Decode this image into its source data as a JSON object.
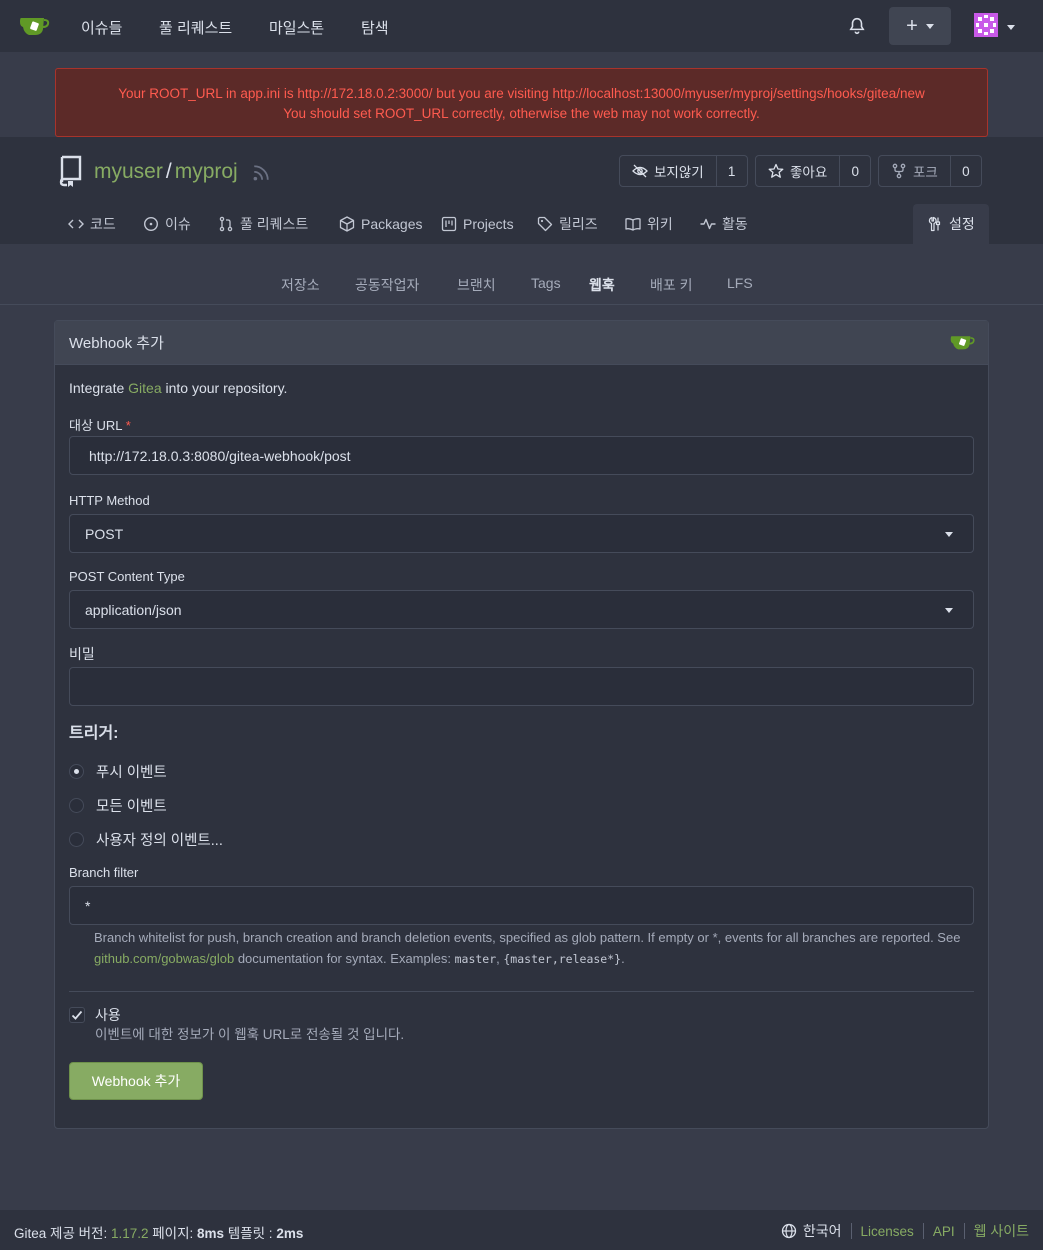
{
  "topnav": {
    "items": [
      "이슈들",
      "풀 리퀘스트",
      "마일스톤",
      "탐색"
    ],
    "plus_label": "+"
  },
  "warning": {
    "line1": "Your ROOT_URL in app.ini is http://172.18.0.2:3000/ but you are visiting http://localhost:13000/myuser/myproj/settings/hooks/gitea/new",
    "line2": "You should set ROOT_URL correctly, otherwise the web may not work correctly."
  },
  "repo": {
    "owner": "myuser",
    "separator": "/",
    "name": "myproj",
    "watch_label": "보지않기",
    "watch_count": "1",
    "star_label": "좋아요",
    "star_count": "0",
    "fork_label": "포크",
    "fork_count": "0"
  },
  "tabs": {
    "code": "코드",
    "issues": "이슈",
    "pulls": "풀 리퀘스트",
    "packages": "Packages",
    "projects": "Projects",
    "releases": "릴리즈",
    "wiki": "위키",
    "activity": "활동",
    "settings": "설정"
  },
  "subnav": [
    "저장소",
    "공동작업자",
    "브랜치",
    "Tags",
    "웹훅",
    "배포 키",
    "LFS"
  ],
  "panel": {
    "title": "Webhook 추가",
    "intro_prefix": "Integrate ",
    "intro_link": "Gitea",
    "intro_suffix": " into your repository.",
    "target_url_label": "대상 URL",
    "target_url_required": "*",
    "target_url_value": "http://172.18.0.3:8080/gitea-webhook/post",
    "http_method_label": "HTTP Method",
    "http_method_value": "POST",
    "content_type_label": "POST Content Type",
    "content_type_value": "application/json",
    "secret_label": "비밀",
    "secret_value": "",
    "triggers_title": "트리거:",
    "trigger_push": "푸시 이벤트",
    "trigger_all": "모든 이벤트",
    "trigger_custom": "사용자 정의 이벤트...",
    "branch_filter_label": "Branch filter",
    "branch_filter_value": "*",
    "help_prefix": "Branch whitelist for push, branch creation and branch deletion events, specified as glob pattern. If empty or *, events for all branches are reported. See ",
    "help_link": "github.com/gobwas/glob",
    "help_mid": " documentation for syntax. Examples: ",
    "help_code1": "master",
    "help_comma": ", ",
    "help_code2": "{master,release*}",
    "help_end": ".",
    "active_label": "사용",
    "active_help": "이벤트에 대한 정보가 이 웹훅 URL로 전송될 것 입니다.",
    "submit_label": "Webhook 추가"
  },
  "footer": {
    "powered_prefix": "Gitea 제공 버전: ",
    "version": "1.17.2",
    "page_prefix": " 페이지: ",
    "page_time": "8ms",
    "template_prefix": " 템플릿 : ",
    "template_time": "2ms",
    "language": "한국어",
    "licenses": "Licenses",
    "api": "API",
    "website": "웹 사이트"
  },
  "colors": {
    "accent": "#87ab63",
    "background": "#383c4a",
    "warning_text": "#ff5b4f"
  }
}
